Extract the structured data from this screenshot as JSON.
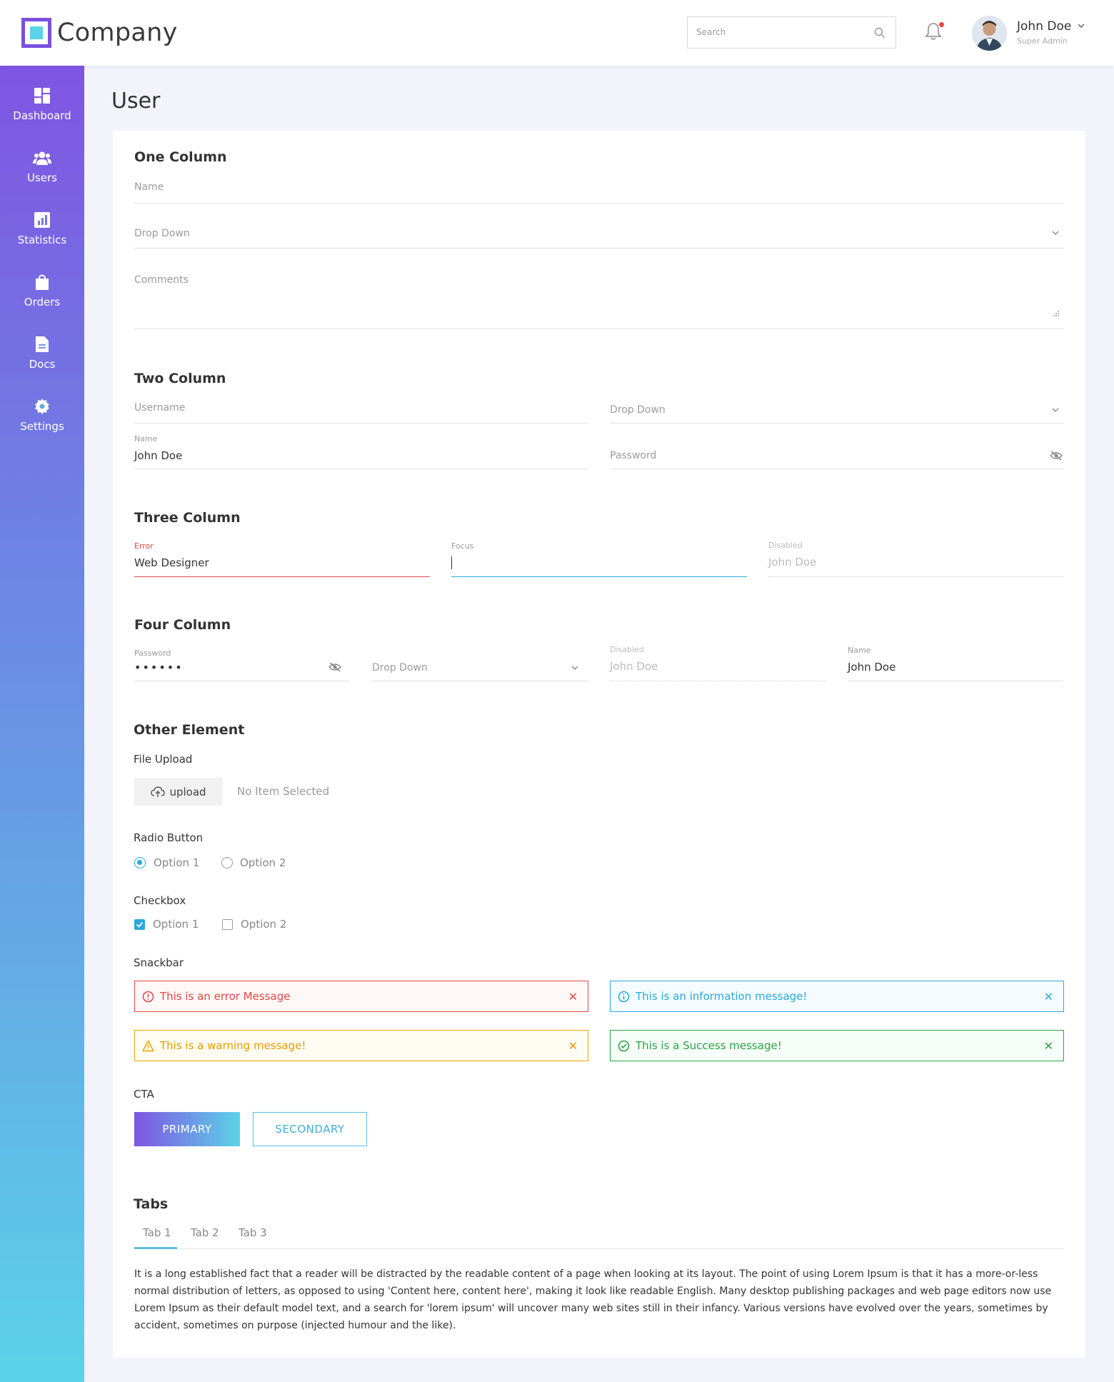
{
  "header": {
    "brand": "Company",
    "search_placeholder": "Search",
    "user_name": "John Doe",
    "user_role": "Super Admin"
  },
  "sidebar": {
    "items": [
      {
        "label": "Dashboard",
        "icon": "dashboard-icon"
      },
      {
        "label": "Users",
        "icon": "users-icon"
      },
      {
        "label": "Statistics",
        "icon": "statistics-icon"
      },
      {
        "label": "Orders",
        "icon": "orders-icon"
      },
      {
        "label": "Docs",
        "icon": "docs-icon"
      },
      {
        "label": "Settings",
        "icon": "settings-icon"
      }
    ]
  },
  "page": {
    "title": "User"
  },
  "one_column": {
    "title": "One Column",
    "name_placeholder": "Name",
    "dropdown_placeholder": "Drop Down",
    "comments_placeholder": "Comments"
  },
  "two_column": {
    "title": "Two Column",
    "username_placeholder": "Username",
    "dropdown_placeholder": "Drop Down",
    "name_label": "Name",
    "name_value": "John Doe",
    "password_placeholder": "Password"
  },
  "three_column": {
    "title": "Three Column",
    "error_label": "Error",
    "error_value": "Web Designer",
    "focus_label": "Focus",
    "disabled_label": "Disabled",
    "disabled_value": "John Doe"
  },
  "four_column": {
    "title": "Four Column",
    "password_label": "Password",
    "password_value": "••••••",
    "dropdown_placeholder": "Drop Down",
    "disabled_label": "Disabled",
    "disabled_value": "John Doe",
    "name_label": "Name",
    "name_value": "John Doe"
  },
  "other": {
    "title": "Other Element",
    "file_upload_label": "File Upload",
    "upload_button": "upload",
    "no_item": "No Item Selected",
    "radio_label": "Radio Button",
    "radio_options": [
      "Option 1",
      "Option 2"
    ],
    "checkbox_label": "Checkbox",
    "checkbox_options": [
      "Option 1",
      "Option 2"
    ],
    "snackbar_label": "Snackbar",
    "snackbars": {
      "error": "This is an error Message",
      "info": "This is an information message!",
      "warning": "This is a warning message!",
      "success": "This is a Success message!"
    },
    "snack_colors": {
      "error": "#e64545",
      "info": "#29a9de",
      "warning": "#f0a500",
      "success": "#2aa642"
    },
    "cta_label": "CTA",
    "primary_button": "PRIMARY",
    "secondary_button": "SECONDARY"
  },
  "tabs": {
    "title": "Tabs",
    "items": [
      "Tab 1",
      "Tab 2",
      "Tab 3"
    ],
    "content": "It is a long established fact that a reader will be distracted by the readable content of a page when looking at its layout. The point of using Lorem Ipsum is that it has a more-or-less normal distribution of letters, as opposed to using 'Content here, content here', making it look like readable English. Many desktop publishing packages and web page editors now use Lorem Ipsum as their default model text, and a search for 'lorem ipsum' will uncover many web sites still in their infancy. Various versions have evolved over the years, sometimes by accident, sometimes on purpose (injected humour and the like)."
  }
}
